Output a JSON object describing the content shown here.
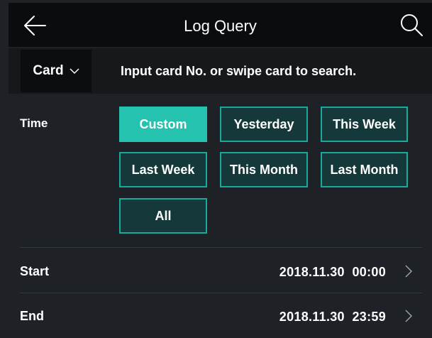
{
  "header": {
    "title": "Log Query",
    "back_icon": "arrow-left-icon",
    "search_icon": "search-icon"
  },
  "search": {
    "type_label": "Card",
    "hint": "Input card No. or swipe card to search."
  },
  "time": {
    "label": "Time",
    "options": [
      "Custom",
      "Yesterday",
      "This Week",
      "Last Week",
      "This Month",
      "Last Month",
      "All"
    ],
    "selected": "Custom"
  },
  "start": {
    "label": "Start",
    "value": "2018.11.30  00:00"
  },
  "end": {
    "label": "End",
    "value": "2018.11.30  23:59"
  },
  "colors": {
    "accent": "#26c2b0",
    "button_border": "#1aa99a",
    "button_bg": "#15393b",
    "background": "#1e2226",
    "header_bg": "#0a0c0e"
  }
}
